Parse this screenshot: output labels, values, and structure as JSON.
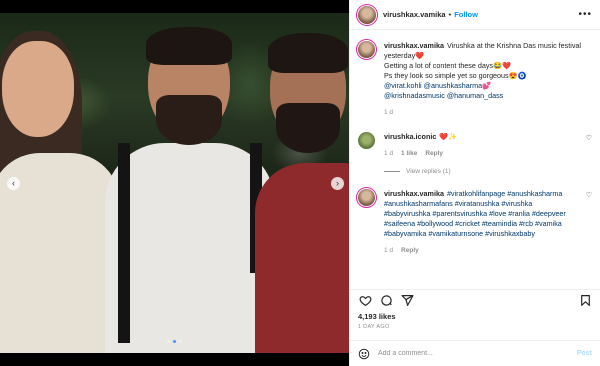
{
  "header": {
    "username": "virushkax.vamika",
    "separator": "•",
    "follow_label": "Follow",
    "more_icon": "more-icon",
    "more_glyph": "•••"
  },
  "media": {
    "prev_glyph": "‹",
    "next_glyph": "›",
    "dot_count": 3,
    "active_dot": 1
  },
  "caption": {
    "username": "virushkax.vamika",
    "line1": "Virushka at the Krishna Das music festival yesterday❤️",
    "line2": "Getting a lot of content these days😂❤️",
    "line3": "Ps they look so simple yet so gorgeous😍🧿",
    "mention1": "@virat.kohli",
    "mention2": "@anushkasharma",
    "emoji": "💕",
    "mention3": "@krishnadasmusic",
    "mention4": "@hanuman_dass",
    "time": "1 d"
  },
  "comments": [
    {
      "username": "virushka.iconic",
      "text": "❤️✨",
      "time": "1 d",
      "likes": "1 like",
      "reply": "Reply",
      "view_replies": "View replies (1)"
    },
    {
      "username": "virushkax.vamika",
      "hashtags": "#viratkohlifanpage #anushkasharma #anushkasharmafans #viratanushka #virushka #babyvirushka #parentsvirushka #love #ranlia #deepveer #saifeena #bollywood #cricket #teamindia #rcb #vamika #babyvamika #vamikaturnsone #virushkaxbaby",
      "time": "1 d",
      "reply": "Reply"
    }
  ],
  "footer": {
    "likes": "4,193 likes",
    "posted": "1 DAY AGO",
    "comment_placeholder": "Add a comment...",
    "post_label": "Post"
  },
  "colors": {
    "link": "#00376b",
    "follow": "#0095f6",
    "post_disabled": "#b2dffc"
  }
}
